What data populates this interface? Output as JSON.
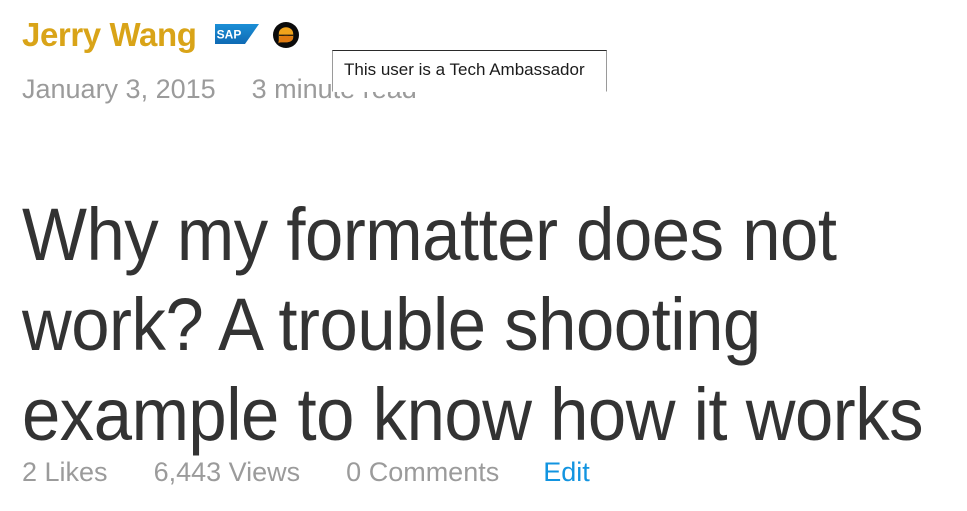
{
  "author": {
    "name": "Jerry Wang",
    "name_color": "#d9a418",
    "badges": [
      {
        "id": "sap-logo-badge",
        "label": "SAP",
        "color": "#1e8ad6"
      },
      {
        "id": "tech-ambassador-badge",
        "label": "Tech Ambassador",
        "color": "#e8960f"
      }
    ]
  },
  "meta": {
    "date": "January 3, 2015",
    "read_time": "3 minute read",
    "color": "#9b9b9b"
  },
  "tooltip": {
    "text": "This user is a Tech Ambassador",
    "background": "#ffffff",
    "border_color": "#9a9a9a",
    "text_color": "#1b1b1b"
  },
  "article": {
    "title_lines": [
      "Why my formatter does not",
      "work? A trouble shooting",
      "example to know how it works"
    ],
    "title_color": "#333333"
  },
  "stats": {
    "likes": "2 Likes",
    "views": "6,443 Views",
    "comments": "0 Comments",
    "edit_label": "Edit",
    "stat_color": "#9b9b9b",
    "edit_color": "#1294e0"
  }
}
